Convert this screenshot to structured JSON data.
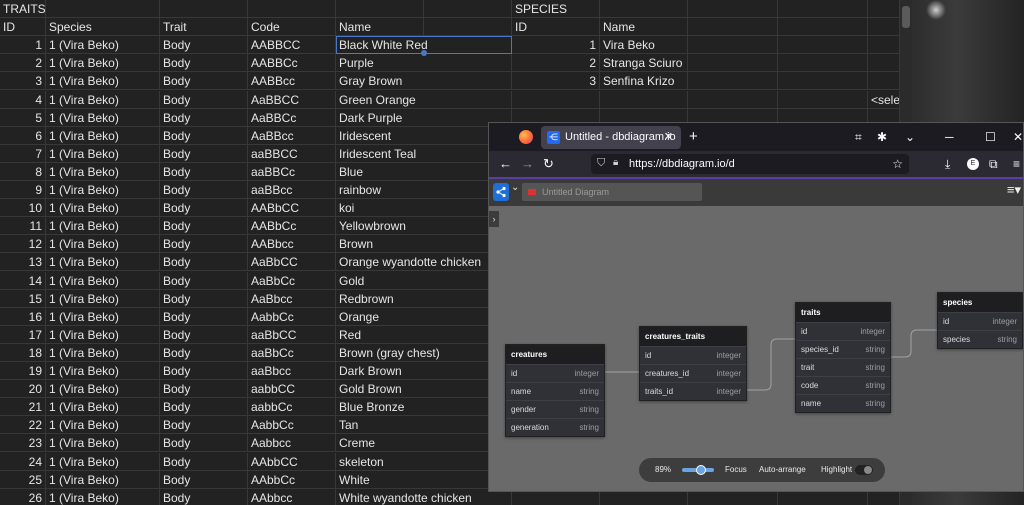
{
  "sheet": {
    "traits_header": "TRAITS",
    "species_header": "SPECIES",
    "traits_columns": [
      "ID",
      "Species",
      "Trait",
      "Code",
      "Name"
    ],
    "species_columns": [
      "ID",
      "Name"
    ],
    "overflow_cell": "<selec",
    "traits_rows": [
      [
        "1",
        "1 (Vira Beko)",
        "Body",
        "AABBCC",
        "Black White Red"
      ],
      [
        "2",
        "1 (Vira Beko)",
        "Body",
        "AABBCc",
        "Purple"
      ],
      [
        "3",
        "1 (Vira Beko)",
        "Body",
        "AABBcc",
        "Gray Brown"
      ],
      [
        "4",
        "1 (Vira Beko)",
        "Body",
        "AaBBCC",
        "Green Orange"
      ],
      [
        "5",
        "1 (Vira Beko)",
        "Body",
        "AaBBCc",
        "Dark Purple"
      ],
      [
        "6",
        "1 (Vira Beko)",
        "Body",
        "AaBBcc",
        "Iridescent"
      ],
      [
        "7",
        "1 (Vira Beko)",
        "Body",
        "aaBBCC",
        "Iridescent Teal"
      ],
      [
        "8",
        "1 (Vira Beko)",
        "Body",
        "aaBBCc",
        "Blue"
      ],
      [
        "9",
        "1 (Vira Beko)",
        "Body",
        "aaBBcc",
        "rainbow"
      ],
      [
        "10",
        "1 (Vira Beko)",
        "Body",
        "AABbCC",
        "koi"
      ],
      [
        "11",
        "1 (Vira Beko)",
        "Body",
        "AABbCc",
        "Yellowbrown"
      ],
      [
        "12",
        "1 (Vira Beko)",
        "Body",
        "AABbcc",
        "Brown"
      ],
      [
        "13",
        "1 (Vira Beko)",
        "Body",
        "AaBbCC",
        "Orange wyandotte chicken"
      ],
      [
        "14",
        "1 (Vira Beko)",
        "Body",
        "AaBbCc",
        "Gold"
      ],
      [
        "15",
        "1 (Vira Beko)",
        "Body",
        "AaBbcc",
        "Redbrown"
      ],
      [
        "16",
        "1 (Vira Beko)",
        "Body",
        "AabbCc",
        "Orange"
      ],
      [
        "17",
        "1 (Vira Beko)",
        "Body",
        "aaBbCC",
        "Red"
      ],
      [
        "18",
        "1 (Vira Beko)",
        "Body",
        "aaBbCc",
        "Brown (gray chest)"
      ],
      [
        "19",
        "1 (Vira Beko)",
        "Body",
        "aaBbcc",
        "Dark Brown"
      ],
      [
        "20",
        "1 (Vira Beko)",
        "Body",
        "aabbCC",
        "Gold Brown"
      ],
      [
        "21",
        "1 (Vira Beko)",
        "Body",
        "aabbCc",
        "Blue Bronze"
      ],
      [
        "22",
        "1 (Vira Beko)",
        "Body",
        "AabbCc",
        "Tan"
      ],
      [
        "23",
        "1 (Vira Beko)",
        "Body",
        "Aabbcc",
        "Creme"
      ],
      [
        "24",
        "1 (Vira Beko)",
        "Body",
        "AAbbCC",
        "skeleton"
      ],
      [
        "25",
        "1 (Vira Beko)",
        "Body",
        "AAbbCc",
        "White"
      ],
      [
        "26",
        "1 (Vira Beko)",
        "Body",
        "AAbbcc",
        "White wyandotte chicken"
      ]
    ],
    "species_rows": [
      [
        "1",
        "Vira Beko"
      ],
      [
        "2",
        "Stranga Sciuro"
      ],
      [
        "3",
        "Senfina Krizo"
      ]
    ]
  },
  "browser": {
    "tab_title": "Untitled - dbdiagram.io",
    "tab_close": "✕",
    "new_tab": "+",
    "url": "https://dbdiagram.io/d",
    "accent_color": "#5b3ea4"
  },
  "app": {
    "diagram_name": "Untitled Diagram",
    "tables": [
      {
        "name": "creatures",
        "fields": [
          [
            "id",
            "integer"
          ],
          [
            "name",
            "string"
          ],
          [
            "gender",
            "string"
          ],
          [
            "generation",
            "string"
          ]
        ]
      },
      {
        "name": "creatures_traits",
        "fields": [
          [
            "id",
            "integer"
          ],
          [
            "creatures_id",
            "integer"
          ],
          [
            "traits_id",
            "integer"
          ]
        ]
      },
      {
        "name": "traits",
        "fields": [
          [
            "id",
            "integer"
          ],
          [
            "species_id",
            "string"
          ],
          [
            "trait",
            "string"
          ],
          [
            "code",
            "string"
          ],
          [
            "name",
            "string"
          ]
        ]
      },
      {
        "name": "species",
        "fields": [
          [
            "id",
            "integer"
          ],
          [
            "species",
            "string"
          ]
        ]
      }
    ],
    "bottombar": {
      "zoom": "89%",
      "zoom_fraction": 0.6,
      "focus": "Focus",
      "auto_arrange": "Auto-arrange",
      "highlight": "Highlight"
    }
  },
  "icons": {
    "browser": [
      "firefox-icon",
      "dbdiagram-tab-icon",
      "list-all-tabs-icon",
      "minimize-icon",
      "maximize-icon",
      "close-icon",
      "back-icon",
      "forward-icon",
      "reload-icon",
      "shield-icon",
      "lock-icon",
      "bookmark-star-icon",
      "download-icon",
      "account-icon",
      "extensions-icon",
      "menu-icon"
    ],
    "app": [
      "dbdiagram-logo-icon",
      "hamburger-menu-icon",
      "sidebar-expand-icon"
    ]
  }
}
